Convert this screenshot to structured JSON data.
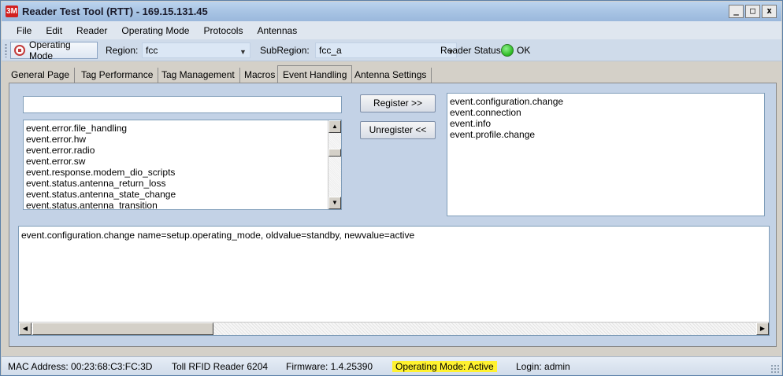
{
  "window": {
    "title": "Reader Test Tool (RTT) - 169.15.131.45",
    "logo_text": "3M",
    "controls": {
      "minimize": "_",
      "maximize": "□",
      "close": "x"
    }
  },
  "menu": [
    {
      "label": "File"
    },
    {
      "label": "Edit"
    },
    {
      "label": "Reader"
    },
    {
      "label": "Operating Mode"
    },
    {
      "label": "Protocols"
    },
    {
      "label": "Antennas"
    }
  ],
  "toolbar": {
    "operating_mode_label": "Operating Mode",
    "region_label": "Region:",
    "region_value": "fcc",
    "subregion_label": "SubRegion:",
    "subregion_value": "fcc_a",
    "reader_status_label": "Reader Status:",
    "reader_status_value": "OK",
    "status_color": "#29b81f"
  },
  "tabs": [
    {
      "label": "General Page"
    },
    {
      "label": "Tag Performance"
    },
    {
      "label": "Tag Management"
    },
    {
      "label": "Macros"
    },
    {
      "label": "Event Handling",
      "active": true
    },
    {
      "label": "Antenna Settings"
    }
  ],
  "event_handling": {
    "filter_input": "",
    "register_button": "Register >>",
    "unregister_button": "Unregister <<",
    "available_events": [
      "event.error.file_handling",
      "event.error.hw",
      "event.error.radio",
      "event.error.sw",
      "event.response.modem_dio_scripts",
      "event.status.antenna_return_loss",
      "event.status.antenna_state_change",
      "event.status.antenna_transition"
    ],
    "registered_events": [
      "event.configuration.change",
      "event.connection",
      "event.info",
      "event.profile.change"
    ],
    "log_lines": [
      "event.configuration.change name=setup.operating_mode, oldvalue=standby, newvalue=active"
    ]
  },
  "statusbar": {
    "mac": "MAC Address: 00:23:68:C3:FC:3D",
    "reader": "Toll RFID Reader 6204",
    "firmware": "Firmware: 1.4.25390",
    "operating_mode": "Operating Mode: Active",
    "login": "Login: admin",
    "highlight_color": "#fff230"
  }
}
